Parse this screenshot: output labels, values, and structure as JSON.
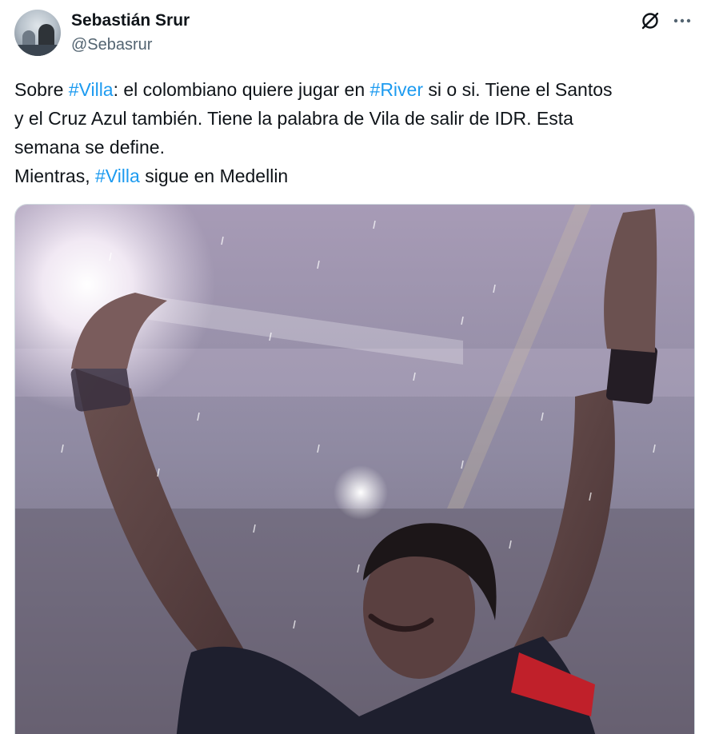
{
  "author": {
    "name": "Sebastián Srur",
    "handle": "@Sebasrur"
  },
  "icons": {
    "grok": "grok-icon",
    "more": "more-icon"
  },
  "tweet": {
    "lines": [
      [
        {
          "t": "Sobre ",
          "tag": false
        },
        {
          "t": "#Villa",
          "tag": true
        },
        {
          "t": ": el colombiano quiere jugar en ",
          "tag": false
        },
        {
          "t": "#River",
          "tag": true
        },
        {
          "t": " si o si. Tiene el Santos",
          "tag": false
        }
      ],
      [
        {
          "t": "y el Cruz Azul también.  Tiene la palabra de Vila de salir de IDR. Esta",
          "tag": false
        }
      ],
      [
        {
          "t": "semana se define.",
          "tag": false
        }
      ],
      [
        {
          "t": "Mientras, ",
          "tag": false
        },
        {
          "t": "#Villa",
          "tag": true
        },
        {
          "t": " sigue en Medellin",
          "tag": false
        }
      ]
    ]
  },
  "colors": {
    "hashtag": "#1d9bf0",
    "text": "#0f1419",
    "secondary": "#536471"
  }
}
